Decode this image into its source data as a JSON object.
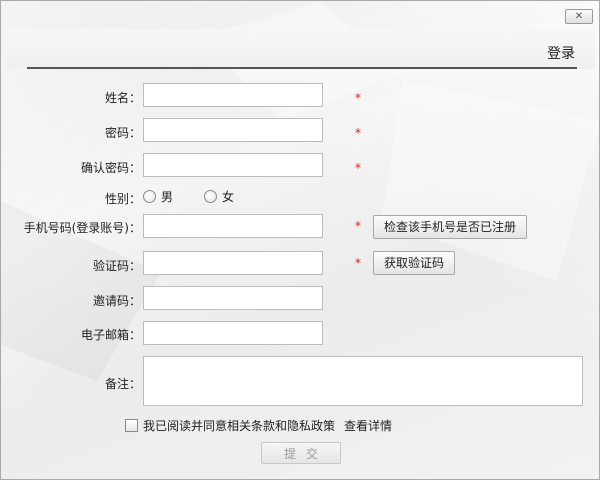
{
  "window": {
    "close_label": "✕",
    "title": "登录"
  },
  "form": {
    "name": {
      "label": "姓名：",
      "value": "",
      "required_mark": "*"
    },
    "password": {
      "label": "密码：",
      "value": "",
      "required_mark": "*"
    },
    "confirm_password": {
      "label": "确认密码：",
      "value": "",
      "required_mark": "*"
    },
    "gender": {
      "label": "性别：",
      "options": [
        {
          "label": "男",
          "selected": false
        },
        {
          "label": "女",
          "selected": false
        }
      ]
    },
    "phone": {
      "label": "手机号码(登录账号)：",
      "value": "",
      "required_mark": "*",
      "check_button_label": "检查该手机号是否已注册"
    },
    "verification_code": {
      "label": "验证码：",
      "value": "",
      "required_mark": "*",
      "get_code_button_label": "获取验证码"
    },
    "invite_code": {
      "label": "邀请码：",
      "value": ""
    },
    "email": {
      "label": "电子邮箱：",
      "value": ""
    },
    "notes": {
      "label": "备注：",
      "value": ""
    },
    "agreement": {
      "checked": false,
      "text": "我已阅读并同意相关条款和隐私政策",
      "details_link": "查看详情"
    },
    "submit_label": "提交"
  }
}
